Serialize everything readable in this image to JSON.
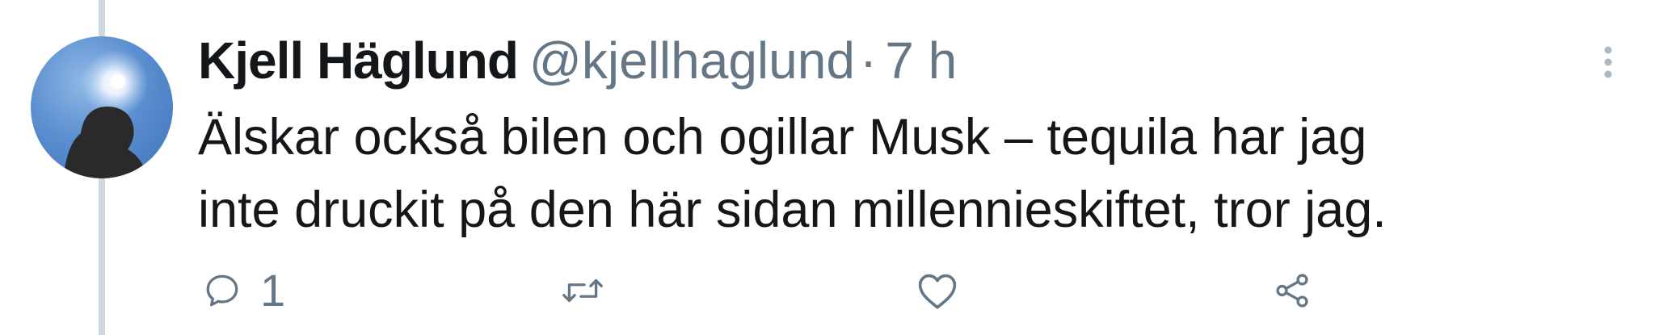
{
  "tweet": {
    "author_name": "Kjell Häglund",
    "author_handle": "@kjellhaglund",
    "separator": "·",
    "timestamp": "7 h",
    "text_lines": [
      "Älskar också bilen och ogillar Musk – tequila har jag",
      "inte druckit på den här sidan millennieskiftet, tror jag."
    ]
  },
  "actions": {
    "reply": {
      "icon": "reply-icon",
      "count": "1"
    },
    "retweet": {
      "icon": "retweet-icon"
    },
    "like": {
      "icon": "heart-icon"
    },
    "share": {
      "icon": "share-icon"
    }
  },
  "colors": {
    "text_primary": "#14171a",
    "text_secondary": "#657786",
    "thread_line": "#cfd9de",
    "background": "#ffffff"
  }
}
